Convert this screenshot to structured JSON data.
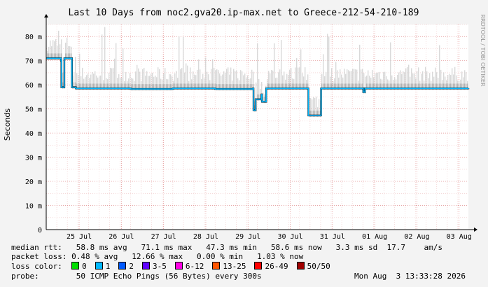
{
  "chart_data": {
    "type": "line",
    "title": "Last 10 Days from noc2.gva20.ip-max.net to Greece-212-54-210-189",
    "ylabel": "Seconds",
    "side_label": "RRDTOOL / TOBI OETIKER",
    "ylim": [
      0,
      85
    ],
    "yticks": [
      0,
      10,
      20,
      30,
      40,
      50,
      60,
      70,
      80
    ],
    "ytick_labels": [
      "0",
      "10 m",
      "20 m",
      "30 m",
      "40 m",
      "50 m",
      "60 m",
      "70 m",
      "80 m"
    ],
    "xlim": [
      0,
      10
    ],
    "xticks": [
      {
        "label": "25 Jul",
        "x": 0.78
      },
      {
        "label": "26 Jul",
        "x": 1.78
      },
      {
        "label": "27 Jul",
        "x": 2.78
      },
      {
        "label": "28 Jul",
        "x": 3.78
      },
      {
        "label": "29 Jul",
        "x": 4.78
      },
      {
        "label": "30 Jul",
        "x": 5.78
      },
      {
        "label": "31 Jul",
        "x": 6.78
      },
      {
        "label": "01 Aug",
        "x": 7.78
      },
      {
        "label": "02 Aug",
        "x": 8.78
      },
      {
        "label": "03 Aug",
        "x": 9.78
      }
    ],
    "grid": true,
    "median_series": {
      "name": "median rtt",
      "x": [
        0,
        0.2,
        0.35,
        0.36,
        0.42,
        0.43,
        0.6,
        0.61,
        0.7,
        1.5,
        2.0,
        3.0,
        4.0,
        4.9,
        4.91,
        4.95,
        4.96,
        5.1,
        5.11,
        5.2,
        5.21,
        5.3,
        5.31,
        6.2,
        6.21,
        6.3,
        6.31,
        6.5,
        6.51,
        7.0,
        7.5,
        7.51,
        7.55,
        8.0,
        9.0,
        9.5,
        9.9,
        10
      ],
      "y": [
        71,
        71,
        70,
        59,
        59,
        71,
        71,
        59,
        58.5,
        58.5,
        58.3,
        58.5,
        58.3,
        58.5,
        49.5,
        49.5,
        54,
        56,
        53,
        53,
        58.5,
        58.5,
        58.5,
        58.5,
        47.3,
        47.3,
        47.3,
        47.3,
        58.5,
        58.5,
        58.5,
        57,
        58.5,
        58.5,
        58.5,
        58.5,
        58.5,
        58.6
      ],
      "loss_color": "#00e000"
    },
    "noise_band": {
      "low": 58,
      "typical_high": 64,
      "spike_high": 84
    },
    "stats": {
      "median_rtt": {
        "label": "median rtt:",
        "avg": "58.8 ms avg",
        "max": "71.1 ms max",
        "min": "47.3 ms min",
        "now": "58.6 ms now",
        "sd": "3.3 ms sd",
        "am": "17.7",
        "am_unit": "am/s"
      },
      "packet_loss": {
        "label": "packet loss:",
        "avg": "0.48 % avg",
        "max": "12.66 % max",
        "min": "0.00 % min",
        "now": "1.03 % now"
      },
      "loss_color": {
        "label": "loss color:",
        "items": [
          {
            "label": "0",
            "color": "#00e000"
          },
          {
            "label": "1",
            "color": "#00b8ff"
          },
          {
            "label": "2",
            "color": "#0059ff"
          },
          {
            "label": "3-5",
            "color": "#5e00ff"
          },
          {
            "label": "6-12",
            "color": "#ff00e4"
          },
          {
            "label": "13-25",
            "color": "#ff5500"
          },
          {
            "label": "26-49",
            "color": "#ff0000"
          },
          {
            "label": "50/50",
            "color": "#a10000"
          }
        ]
      },
      "probe": {
        "label": "probe:",
        "text": "50 ICMP Echo Pings (56 Bytes) every 300s",
        "date": "Mon Aug  3 13:33:28 2026"
      }
    }
  }
}
